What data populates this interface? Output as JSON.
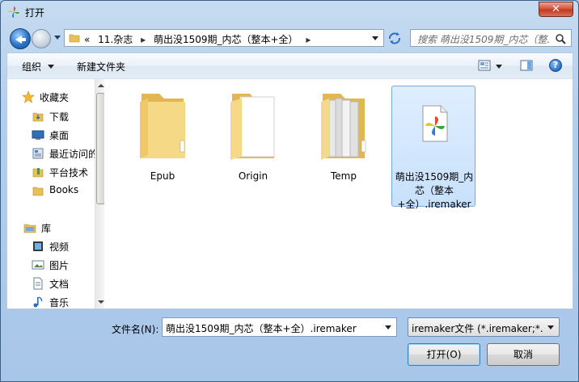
{
  "window": {
    "title": "打开",
    "close_label": "✕"
  },
  "address": {
    "overflow": "«",
    "crumbs": [
      "11.杂志",
      "萌出没1509期_内芯（整本+全）"
    ],
    "separator": "▸",
    "search_placeholder": "搜索 萌出没1509期_内芯（整..."
  },
  "toolbar": {
    "organize_label": "组织",
    "new_folder_label": "新建文件夹",
    "help_label": "?"
  },
  "nav": {
    "favorites": {
      "label": "收藏夹",
      "items": [
        "下载",
        "桌面",
        "最近访问的",
        "平台技术",
        "Books"
      ]
    },
    "library": {
      "label": "库",
      "items": [
        "视频",
        "图片",
        "文档",
        "音乐"
      ]
    }
  },
  "files": [
    {
      "name": "Epub",
      "type": "folder"
    },
    {
      "name": "Origin",
      "type": "folder"
    },
    {
      "name": "Temp",
      "type": "folder"
    },
    {
      "name": "萌出没1509期_内芯（整本+全）.iremaker",
      "type": "file",
      "selected": true
    }
  ],
  "bottom": {
    "filename_label": "文件名(N):",
    "filename_value": "萌出没1509期_内芯（整本+全）.iremaker",
    "filetype_value": "iremaker文件 (*.iremaker;*.in",
    "open_label": "打开(O)",
    "cancel_label": "取消"
  },
  "colors": {
    "folder": "#f3d27a",
    "selection": "#cce4fc",
    "close_button": "#c8432a"
  }
}
